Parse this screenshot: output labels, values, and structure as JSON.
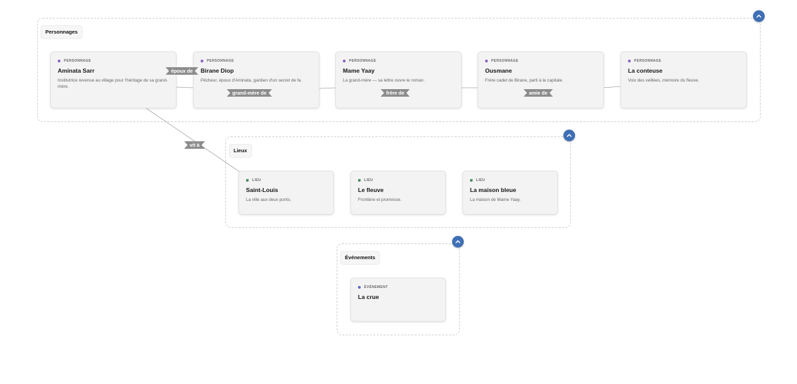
{
  "colors": {
    "personnage": "#8b63c2",
    "lieu": "#4e8a62",
    "evenement": "#5a6fc6",
    "collapse_button": "#3f6fb5",
    "edge_label_bg": "#8c8c8c"
  },
  "groups": {
    "personnages": {
      "label": "Personnages",
      "collapse_icon": "chevron-up-icon"
    },
    "lieux": {
      "label": "Lieux",
      "collapse_icon": "chevron-up-icon"
    },
    "evenements": {
      "label": "Événements",
      "collapse_icon": "chevron-up-icon"
    }
  },
  "nodes": {
    "aminata": {
      "type": "PERSONNAGE",
      "name": "Aminata Sarr",
      "desc": "Institutrice revenue au village pour l'héritage de sa grand-mère."
    },
    "birane": {
      "type": "PERSONNAGE",
      "name": "Birane Diop",
      "desc": "Pêcheur, époux d'Aminata, gardien d'un secret de fa"
    },
    "mame": {
      "type": "PERSONNAGE",
      "name": "Mame Yaay",
      "desc": "La grand-mère — sa lettre ouvre le roman."
    },
    "ousmane": {
      "type": "PERSONNAGE",
      "name": "Ousmane",
      "desc": "Frère cadet de Birane, parti à la capitale."
    },
    "conteuse": {
      "type": "PERSONNAGE",
      "name": "La conteuse",
      "desc": "Voix des veillées, mémoire du fleuve."
    },
    "saint_louis": {
      "type": "LIEU",
      "name": "Saint-Louis",
      "desc": "La ville aux deux ponts."
    },
    "fleuve": {
      "type": "LIEU",
      "name": "Le fleuve",
      "desc": "Frontière et promesse."
    },
    "maison": {
      "type": "LIEU",
      "name": "La maison bleue",
      "desc": "La maison de Mame Yaay."
    },
    "crue": {
      "type": "ÉVÉNEMENT",
      "name": "La crue"
    }
  },
  "edges": {
    "epoux": "époux de",
    "grand_mere": "grand-mère de",
    "frere": "frère de",
    "amie": "amie de",
    "vit": "vit à"
  }
}
